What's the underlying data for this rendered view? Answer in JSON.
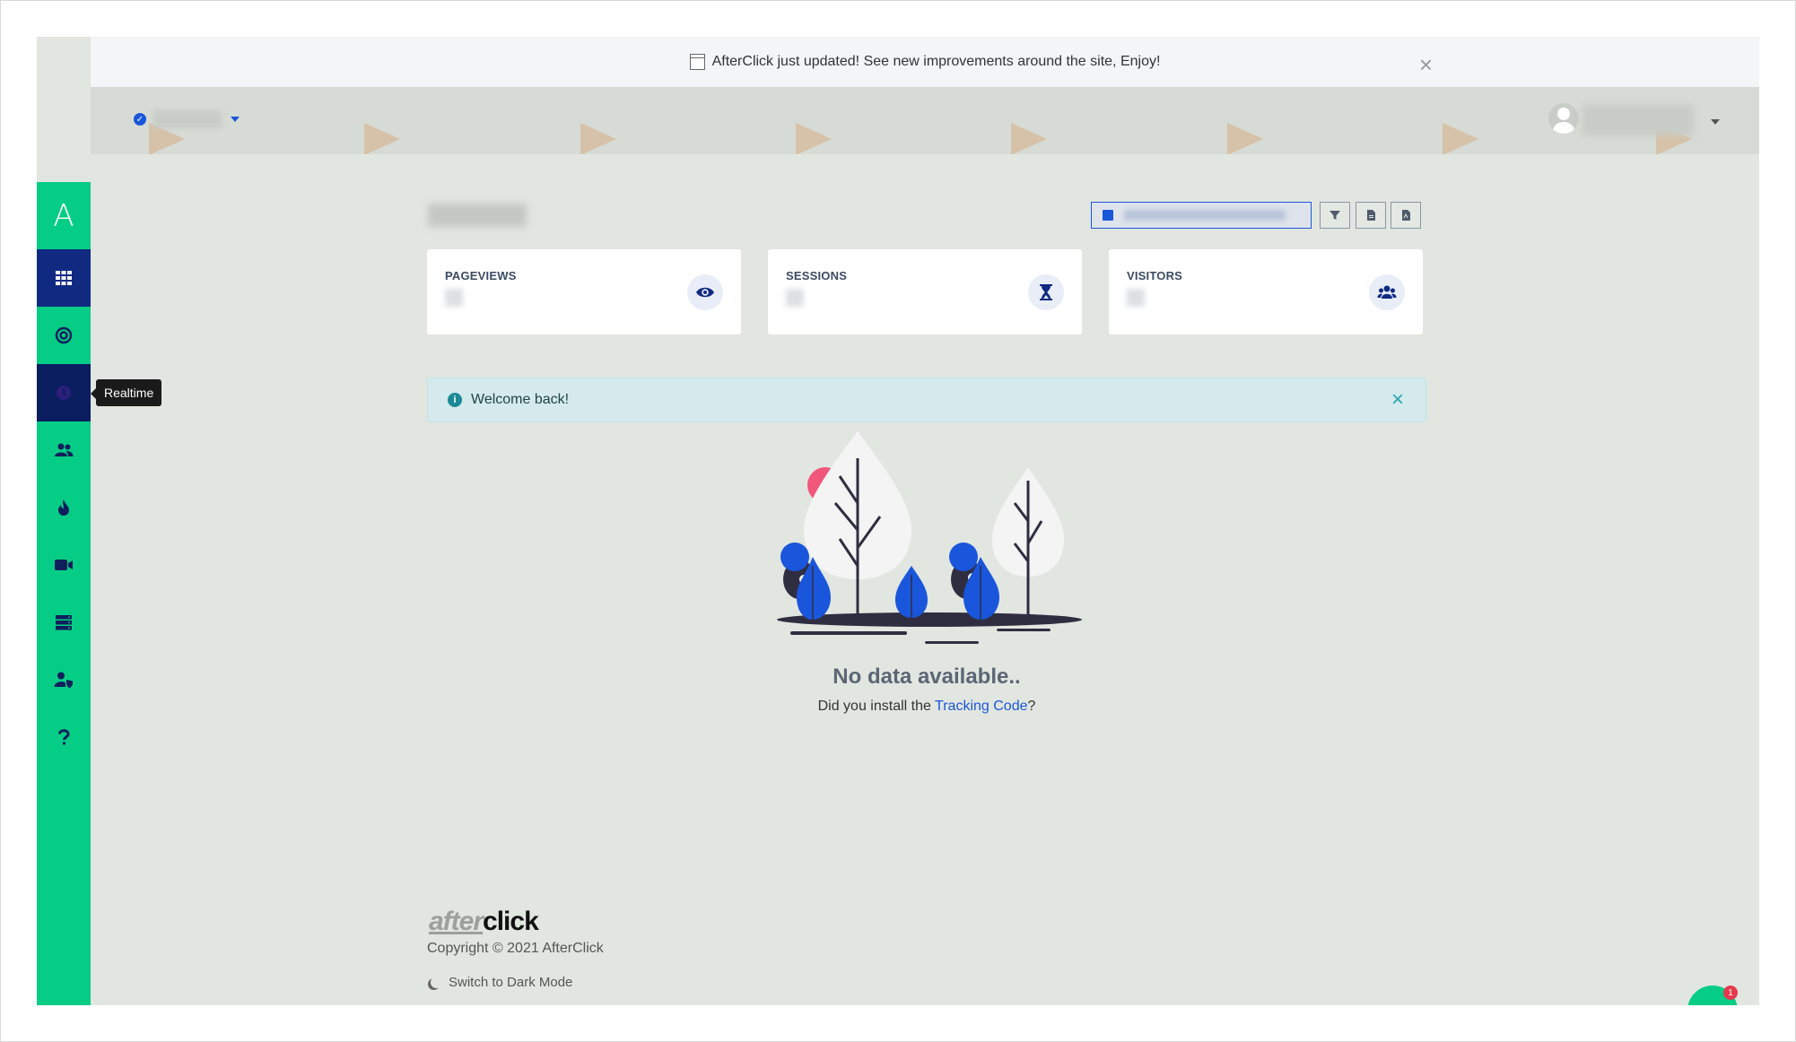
{
  "notice": {
    "text": "AfterClick just updated! See new improvements around the site, Enjoy!",
    "close": "×"
  },
  "sidebar": {
    "logo": "A",
    "items": [
      {
        "name": "dashboard",
        "icon": "grid-icon"
      },
      {
        "name": "goals",
        "icon": "target-icon"
      },
      {
        "name": "realtime",
        "icon": "clock-icon"
      },
      {
        "name": "visitors",
        "icon": "users-icon"
      },
      {
        "name": "heatmaps",
        "icon": "fire-icon"
      },
      {
        "name": "recordings",
        "icon": "video-icon"
      },
      {
        "name": "database",
        "icon": "server-icon"
      },
      {
        "name": "user-privacy",
        "icon": "user-shield-icon"
      },
      {
        "name": "help",
        "icon": "question-icon"
      }
    ],
    "tooltip": "Realtime"
  },
  "cards": [
    {
      "label": "PAGEVIEWS",
      "icon": "eye-icon"
    },
    {
      "label": "SESSIONS",
      "icon": "hourglass-icon"
    },
    {
      "label": "VISITORS",
      "icon": "users-icon"
    }
  ],
  "alert": {
    "text": "Welcome back!",
    "close": "×"
  },
  "empty": {
    "title": "No data available..",
    "hint_prefix": "Did you install the ",
    "hint_link": "Tracking Code",
    "hint_suffix": "?"
  },
  "footer": {
    "logo_part1": "after",
    "logo_part2": "click",
    "copyright": "Copyright © 2021 AfterClick",
    "darkmode": "Switch to Dark Mode"
  },
  "chat": {
    "badge": "1"
  },
  "colors": {
    "sidebar": "#06cd85",
    "accent": "#1a56db",
    "navy": "#102a82",
    "alert_bg": "#d4eaec"
  }
}
